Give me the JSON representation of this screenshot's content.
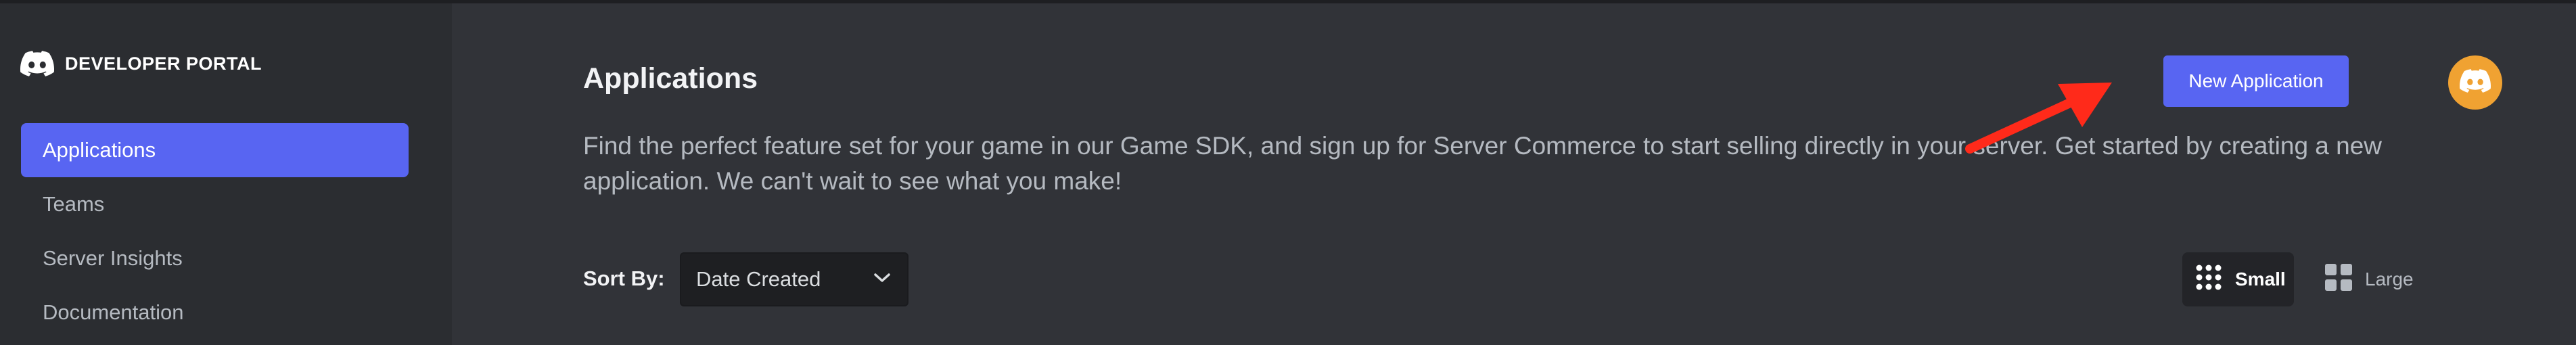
{
  "brand": {
    "name": "DEVELOPER PORTAL"
  },
  "sidebar": {
    "items": [
      {
        "label": "Applications",
        "active": true
      },
      {
        "label": "Teams",
        "active": false
      },
      {
        "label": "Server Insights",
        "active": false
      },
      {
        "label": "Documentation",
        "active": false
      }
    ]
  },
  "main": {
    "title": "Applications",
    "description": "Find the perfect feature set for your game in our Game SDK, and sign up for Server Commerce to start selling directly in your server. Get started by creating a new application. We can't wait to see what you make!",
    "new_app_label": "New Application"
  },
  "sort": {
    "label": "Sort By:",
    "selected": "Date Created"
  },
  "view_toggle": {
    "small_label": "Small",
    "large_label": "Large",
    "selected": "Small"
  },
  "icons": {
    "brand_logo": "discord-logo-icon",
    "avatar": "discord-avatar-icon",
    "sort_chevron": "chevron-down-icon",
    "small_view": "grid-small-icon",
    "large_view": "grid-large-icon",
    "annotation": "red-arrow-icon"
  },
  "colors": {
    "accent": "#5865f2",
    "background": "#313338",
    "sidebar": "#2b2d31",
    "avatar": "#f0a232",
    "annotation_arrow": "#ff2a1a"
  }
}
